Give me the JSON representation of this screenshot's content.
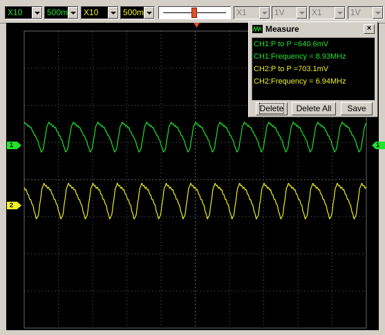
{
  "colors": {
    "ch1": "#22e22e",
    "ch2": "#f0f028",
    "grid": "#6a6a6a",
    "screen": "#000000"
  },
  "toolbar": {
    "ch1_probe": "X10",
    "ch1_volts_div": "500m",
    "ch2_probe": "X10",
    "ch2_volts_div": "500m",
    "ch3_probe": "X1",
    "ch3_volts_div": "1V",
    "ch4_probe": "X1",
    "ch4_volts_div": "1V"
  },
  "markers": {
    "ch1_label": "1",
    "ch2_label": "2",
    "right_label": "1"
  },
  "measure": {
    "title": "Measure",
    "close_glyph": "×",
    "ch1_p2p": "CH1:P to P =640.6mV",
    "ch1_freq": "CH1:Frequency = 8.93MHz",
    "ch2_p2p": "CH2:P to P =703.1mV",
    "ch2_freq": "CH2:Frequency = 6.94MHz",
    "delete_label": "Delete",
    "delete_all_label": "Delete All",
    "save_label": "Save"
  }
}
